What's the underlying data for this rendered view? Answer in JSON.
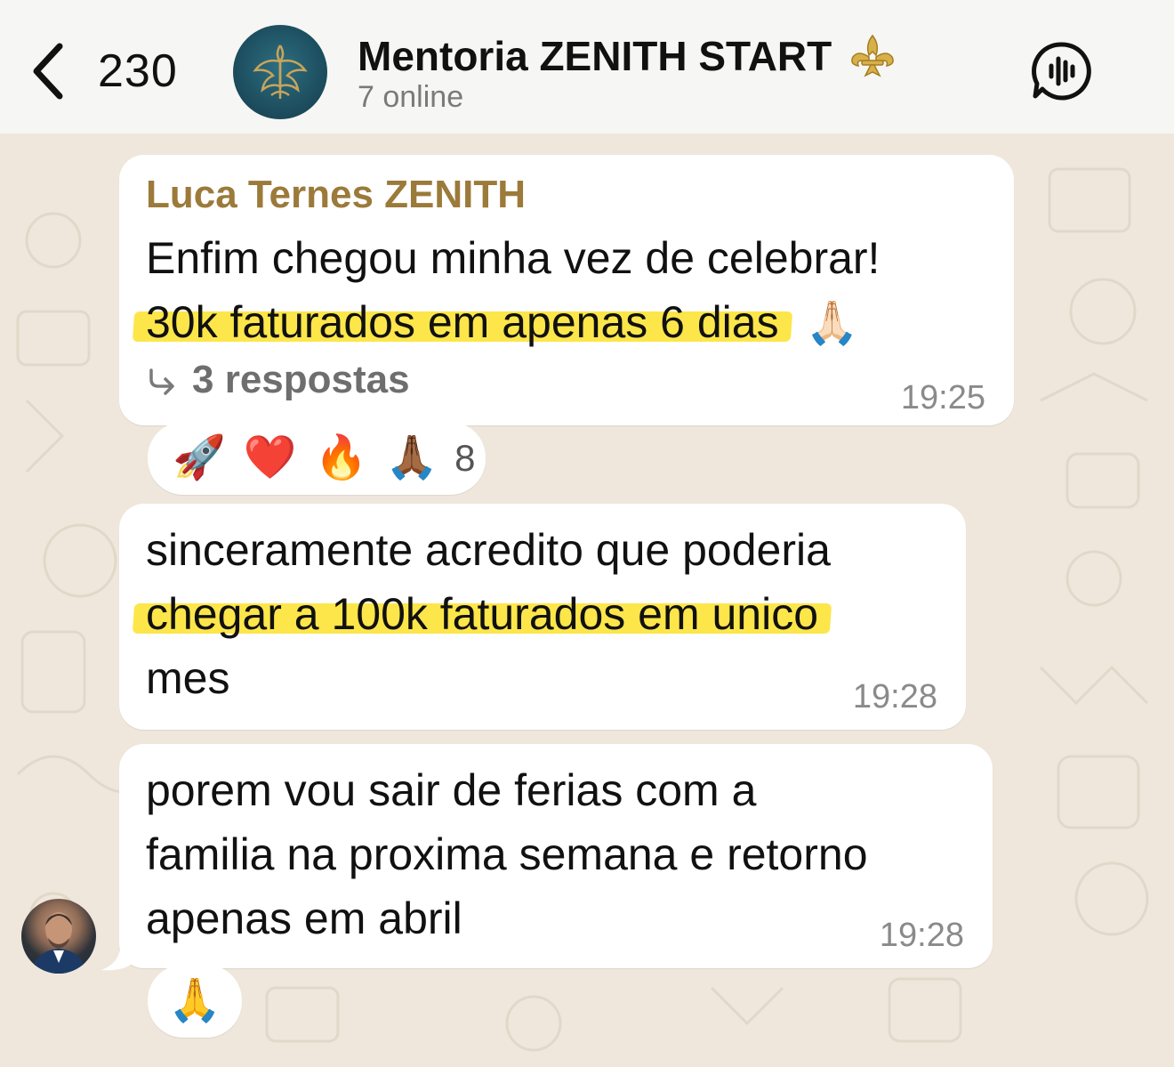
{
  "header": {
    "back_count": "230",
    "title": "Mentoria ZENITH START",
    "status": "7 online"
  },
  "messages": [
    {
      "sender": "Luca Ternes ZENITH",
      "line1": "Enfim chegou minha vez de celebrar!",
      "line2": "30k faturados em apenas 6 dias",
      "line2_emoji": "🙏🏻",
      "replies": "3 respostas",
      "time": "19:25",
      "reactions": [
        "🚀",
        "❤️",
        "🔥",
        "🙏🏾"
      ],
      "reaction_count": "8"
    },
    {
      "line1": "sinceramente acredito que poderia",
      "line2": "chegar a 100k faturados em unico",
      "line3": "mes",
      "time": "19:28"
    },
    {
      "line1": "porem vou sair de ferias com a",
      "line2": "familia na proxima semana e retorno",
      "line3": "apenas em abril",
      "time": "19:28",
      "reactions": [
        "🙏"
      ]
    }
  ],
  "colors": {
    "sender_name": "#9b7a3a",
    "highlight": "#fde64a",
    "wallpaper": "#efe7dc"
  }
}
